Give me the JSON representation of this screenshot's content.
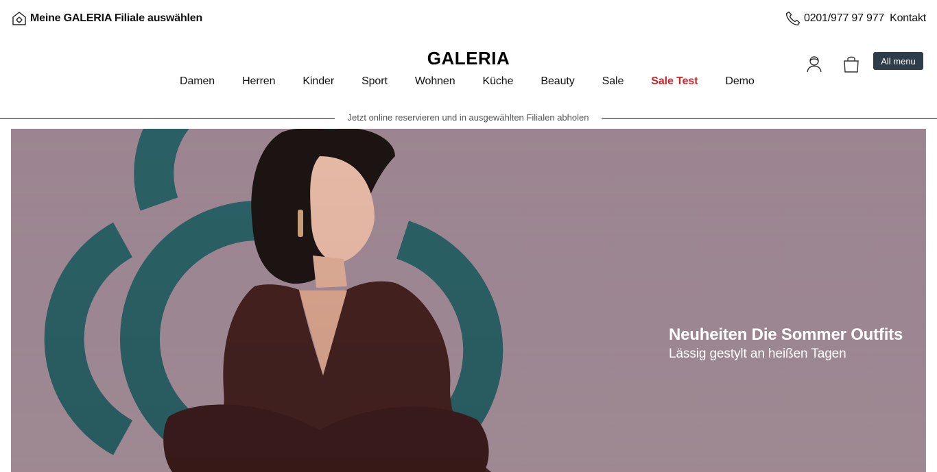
{
  "topbar": {
    "store_select_label": "Meine GALERIA Filiale auswählen",
    "phone_number": "0201/977 97 977",
    "contact_label": "Kontakt"
  },
  "header": {
    "logo_text": "GALERIA",
    "all_menu_label": "All menu"
  },
  "nav": {
    "items": [
      {
        "label": "Damen"
      },
      {
        "label": "Herren"
      },
      {
        "label": "Kinder"
      },
      {
        "label": "Sport"
      },
      {
        "label": "Wohnen"
      },
      {
        "label": "Küche"
      },
      {
        "label": "Beauty"
      },
      {
        "label": "Sale"
      },
      {
        "label": "Sale Test",
        "highlight": true
      },
      {
        "label": "Demo"
      }
    ]
  },
  "promo": {
    "text": "Jetzt online reservieren und in ausgewählten Filialen abholen"
  },
  "hero": {
    "title": "Neuheiten Die Sommer Outfits",
    "subtitle": "Lässig gestylt an heißen Tagen"
  },
  "colors": {
    "accent_red": "#d2232a",
    "menu_button": "#2e3d49",
    "hero_bg": "#a18a96",
    "hero_shape": "#2a6065"
  },
  "icons": [
    "store-icon",
    "phone-icon",
    "user-icon",
    "shopping-bag-icon"
  ]
}
